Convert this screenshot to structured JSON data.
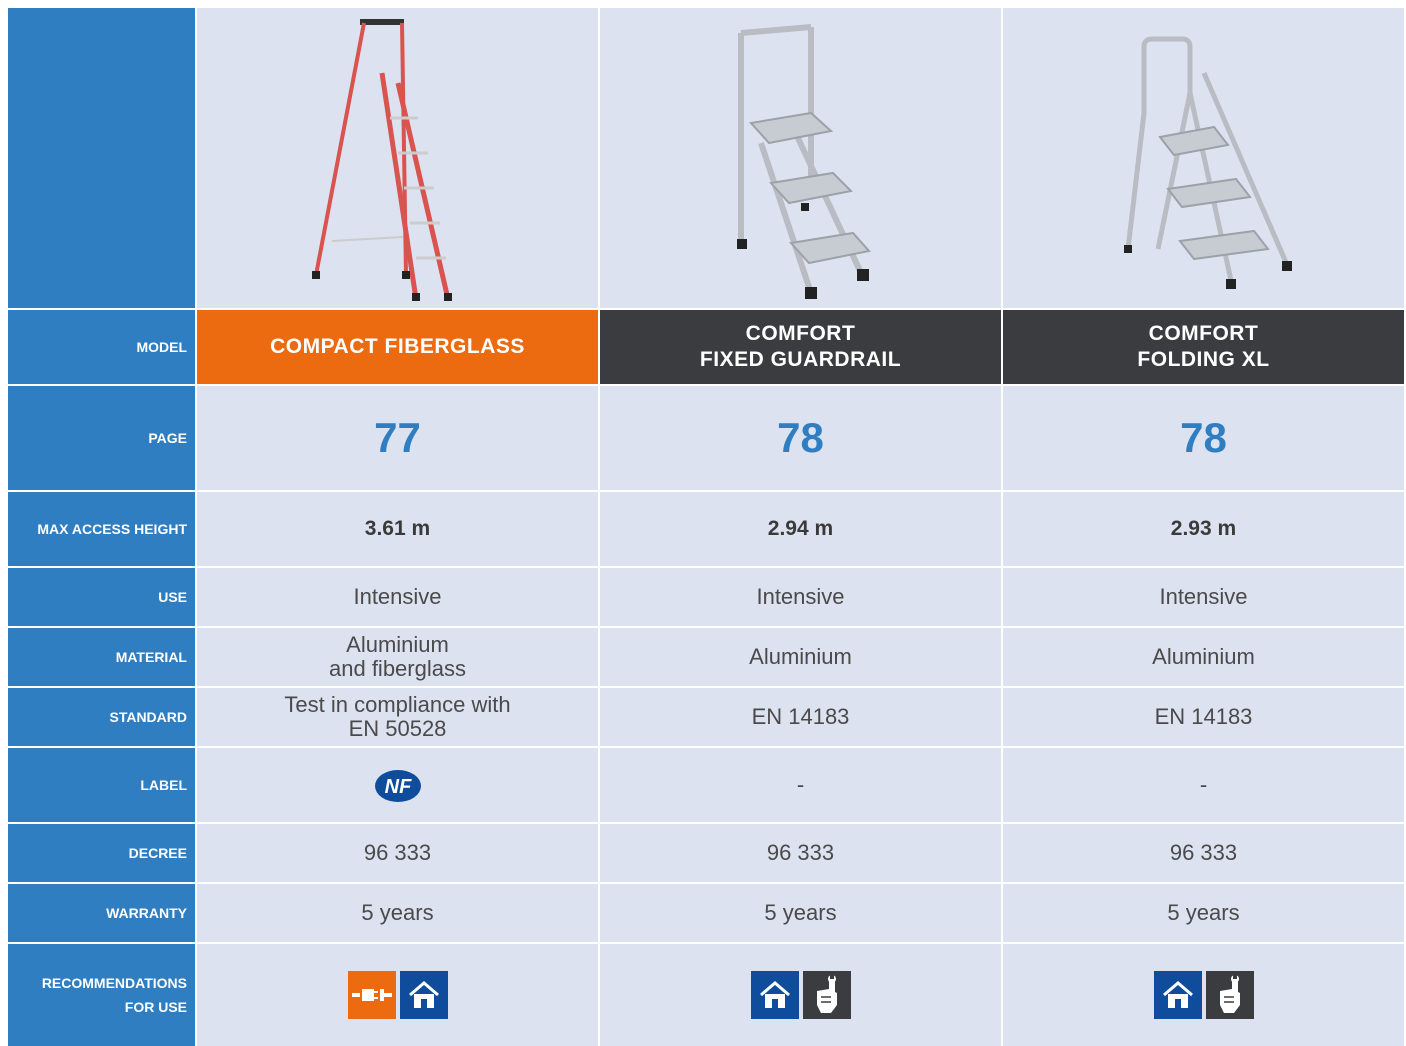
{
  "labels": {
    "model": "MODEL",
    "page": "PAGE",
    "max_access_height": "MAX ACCESS HEIGHT",
    "use": "USE",
    "material": "MATERIAL",
    "standard": "STANDARD",
    "label": "LABEL",
    "decree": "DECREE",
    "warranty": "WARRANTY",
    "recommendations": "RECOMMENDATIONS\nFOR USE"
  },
  "products": [
    {
      "model": "COMPACT FIBERGLASS",
      "page": "77",
      "max_access_height": "3.61 m",
      "use": "Intensive",
      "material": "Aluminium\nand fiberglass",
      "standard": "Test in compliance with\nEN 50528",
      "label": "NF",
      "decree": "96 333",
      "warranty": "5 years",
      "recommendation_icons": [
        "electric-plug-icon",
        "house-icon"
      ]
    },
    {
      "model": "COMFORT\nFIXED GUARDRAIL",
      "page": "78",
      "max_access_height": "2.94 m",
      "use": "Intensive",
      "material": "Aluminium",
      "standard": "EN 14183",
      "label": "-",
      "decree": "96 333",
      "warranty": "5 years",
      "recommendation_icons": [
        "house-icon",
        "hand-wrench-icon"
      ]
    },
    {
      "model": "COMFORT\nFOLDING XL",
      "page": "78",
      "max_access_height": "2.93 m",
      "use": "Intensive",
      "material": "Aluminium",
      "standard": "EN 14183",
      "label": "-",
      "decree": "96 333",
      "warranty": "5 years",
      "recommendation_icons": [
        "house-icon",
        "hand-wrench-icon"
      ]
    }
  ],
  "colors": {
    "label_blue": "#2f7ec2",
    "highlight_orange": "#ec6b10",
    "dark_header": "#3b3c3f",
    "cell_bg": "#dde2f1",
    "icon_blue": "#0f4d9c"
  }
}
